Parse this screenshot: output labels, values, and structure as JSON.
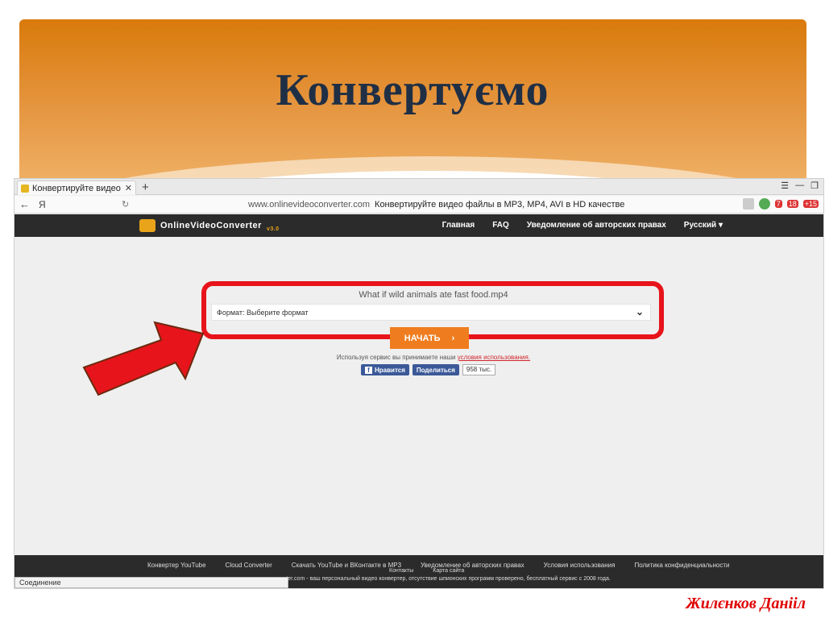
{
  "slide": {
    "title": "Конвертуємо",
    "author": "Жилєнков Данііл"
  },
  "browser": {
    "tab_title": "Конвертируйте видео ф",
    "tab_close": "✕",
    "new_tab": "+",
    "yandex_label": "Я",
    "url_domain": "www.onlinevideoconverter.com",
    "url_title": "Конвертируйте видео файлы в MP3, MP4, AVI в HD качестве",
    "ext_badge_1": "7",
    "ext_badge_2": "18",
    "ext_badge_3": "+15"
  },
  "site": {
    "logo_text": "OnlineVideoConverter",
    "logo_version": "v3.0",
    "nav": [
      "Главная",
      "FAQ",
      "Уведомление об авторских правах",
      "Русский ▾"
    ]
  },
  "converter": {
    "file_name": "What if wild animals ate fast food.mp4",
    "format_label": "Формат: Выберите формат",
    "start_button": "НАЧАТЬ",
    "start_arrow": "›",
    "terms_text": "Используя сервис вы принимаете наши",
    "terms_link": "условия использования.",
    "like_button": "Нравится",
    "share_button": "Поделиться",
    "like_count": "958 тыс."
  },
  "footer": {
    "links": [
      "Конвертер YouTube",
      "Cloud Converter",
      "Скачать YouTube и ВКонтакте в MP3",
      "Уведомление об авторских правах",
      "Условия использования",
      "Политика конфиденциальности"
    ],
    "links2": [
      "Контакты",
      "Карта сайта"
    ],
    "copyright": "rter.com - ваш персональный видео конвертер, отсутствие шпионских программ проверено, бесплатный сервис с 2008 года.",
    "status": "Соединение"
  },
  "colors": {
    "highlight_red": "#e8141b",
    "accent_orange": "#ef7d1f",
    "title_navy": "#1f2f45"
  }
}
